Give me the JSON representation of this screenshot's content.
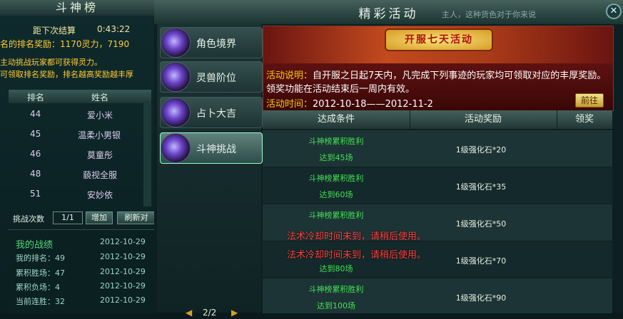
{
  "rank_panel": {
    "title": "斗神榜",
    "countdown_label": "距下次结算",
    "countdown_value": "0:43:22",
    "reward_text": "名的排名奖励：1170灵力，7190",
    "note1": "主动挑战玩家都可获得灵力。",
    "note2": "可领取排名奖励，排名越高奖励越丰厚",
    "headers": [
      "排名",
      "姓名"
    ],
    "rows": [
      {
        "rank": "44",
        "name": "爱小米"
      },
      {
        "rank": "45",
        "name": "温柔小男银"
      },
      {
        "rank": "46",
        "name": "莫童彤"
      },
      {
        "rank": "48",
        "name": "藐视全服"
      },
      {
        "rank": "51",
        "name": "安妙依"
      }
    ],
    "challenge_label": "挑战次数",
    "challenge_value": "1/1",
    "add_label": "增加",
    "refresh_label": "刷新对",
    "record": {
      "title": "我的战绩",
      "items": [
        {
          "text": "",
          "date": "2012-10-29"
        },
        {
          "text": "我的排名：49",
          "date": "2012-10-29"
        },
        {
          "text": "累积胜场：47",
          "date": "2012-10-29"
        },
        {
          "text": "累积负场：4",
          "date": "2012-10-29"
        },
        {
          "text": "当前连胜：32",
          "date": "2012-10-29"
        }
      ]
    }
  },
  "main": {
    "title": "精彩活动",
    "marquee": "主人，这种货色对于你来说",
    "close_label": "✕",
    "menu": [
      {
        "label": "角色境界",
        "active": false
      },
      {
        "label": "灵兽阶位",
        "active": false
      },
      {
        "label": "占卜大吉",
        "active": false
      },
      {
        "label": "斗神挑战",
        "active": true
      }
    ],
    "pager": {
      "prev": "◀",
      "page": "2/2",
      "next": "▶"
    },
    "banner": {
      "tag": "开服七天活动",
      "desc_label": "活动说明：",
      "desc_text": "自开服之日起7天内，凡完成下列事迹的玩家均可领取对应的丰厚奖励。领奖功能在活动结束后一周内有效。",
      "time_label": "活动时间：",
      "time_value": "2012-10-18——2012-11-2",
      "detail_button": "前往"
    },
    "table": {
      "headers": [
        "达成条件",
        "活动奖励",
        "领奖"
      ],
      "rows": [
        {
          "cond_a": "斗神榜累积胜利",
          "cond_b": "达到45场",
          "reward": "1级强化石*20"
        },
        {
          "cond_a": "斗神榜累积胜利",
          "cond_b": "达到60场",
          "reward": "1级强化石*35"
        },
        {
          "cond_a": "斗神榜累积胜利",
          "cond_b": "",
          "reward": "1级强化石*50"
        },
        {
          "cond_a": "",
          "cond_b": "达到80场",
          "reward": "1级强化石*70"
        },
        {
          "cond_a": "斗神榜累积胜利",
          "cond_b": "达到100场",
          "reward": "1级强化石*90"
        }
      ]
    },
    "system_messages": [
      "法术冷却时间未到，请稍后使用。",
      "法术冷却时间未到，请稍后使用。"
    ]
  },
  "colors": {
    "accent_gold": "#ffcc33",
    "condition_green": "#43e053",
    "warning_red": "#ff4040",
    "banner_red": "#7a1a18"
  },
  "icons": {
    "menu_icon": "purple-orb-icon",
    "close": "close-icon"
  }
}
